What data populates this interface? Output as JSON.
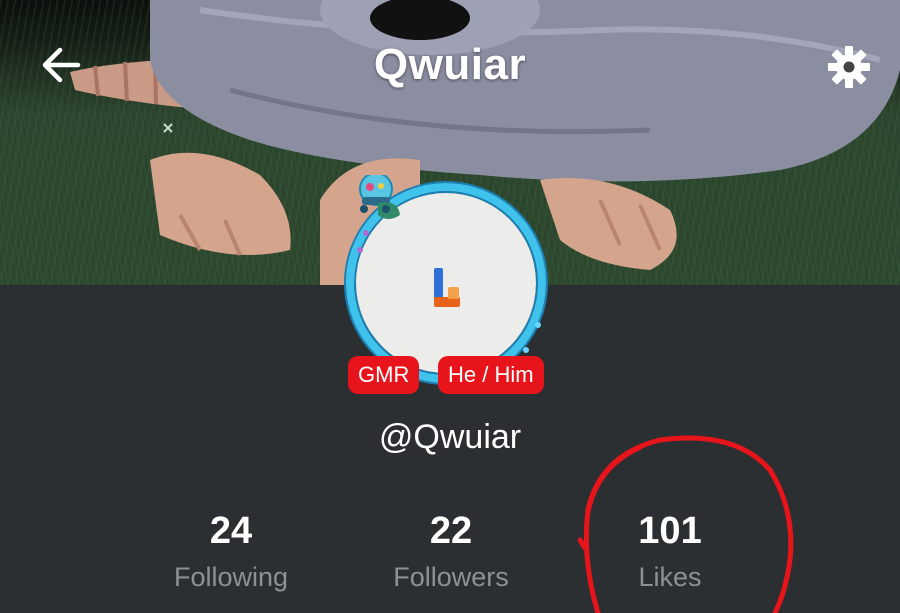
{
  "header": {
    "title": "Qwuiar",
    "back_icon": "arrow-left-icon",
    "settings_icon": "gear-icon"
  },
  "profile": {
    "handle": "@Qwuiar",
    "badges": [
      "GMR",
      "He / Him"
    ],
    "badge_color": "#e8141b",
    "ring_color": "#3fc3ec"
  },
  "stats": [
    {
      "value": "24",
      "label": "Following"
    },
    {
      "value": "22",
      "label": "Followers"
    },
    {
      "value": "101",
      "label": "Likes"
    }
  ],
  "annotation": {
    "color": "#e8141b",
    "shape": "hand-drawn circle around Likes"
  }
}
